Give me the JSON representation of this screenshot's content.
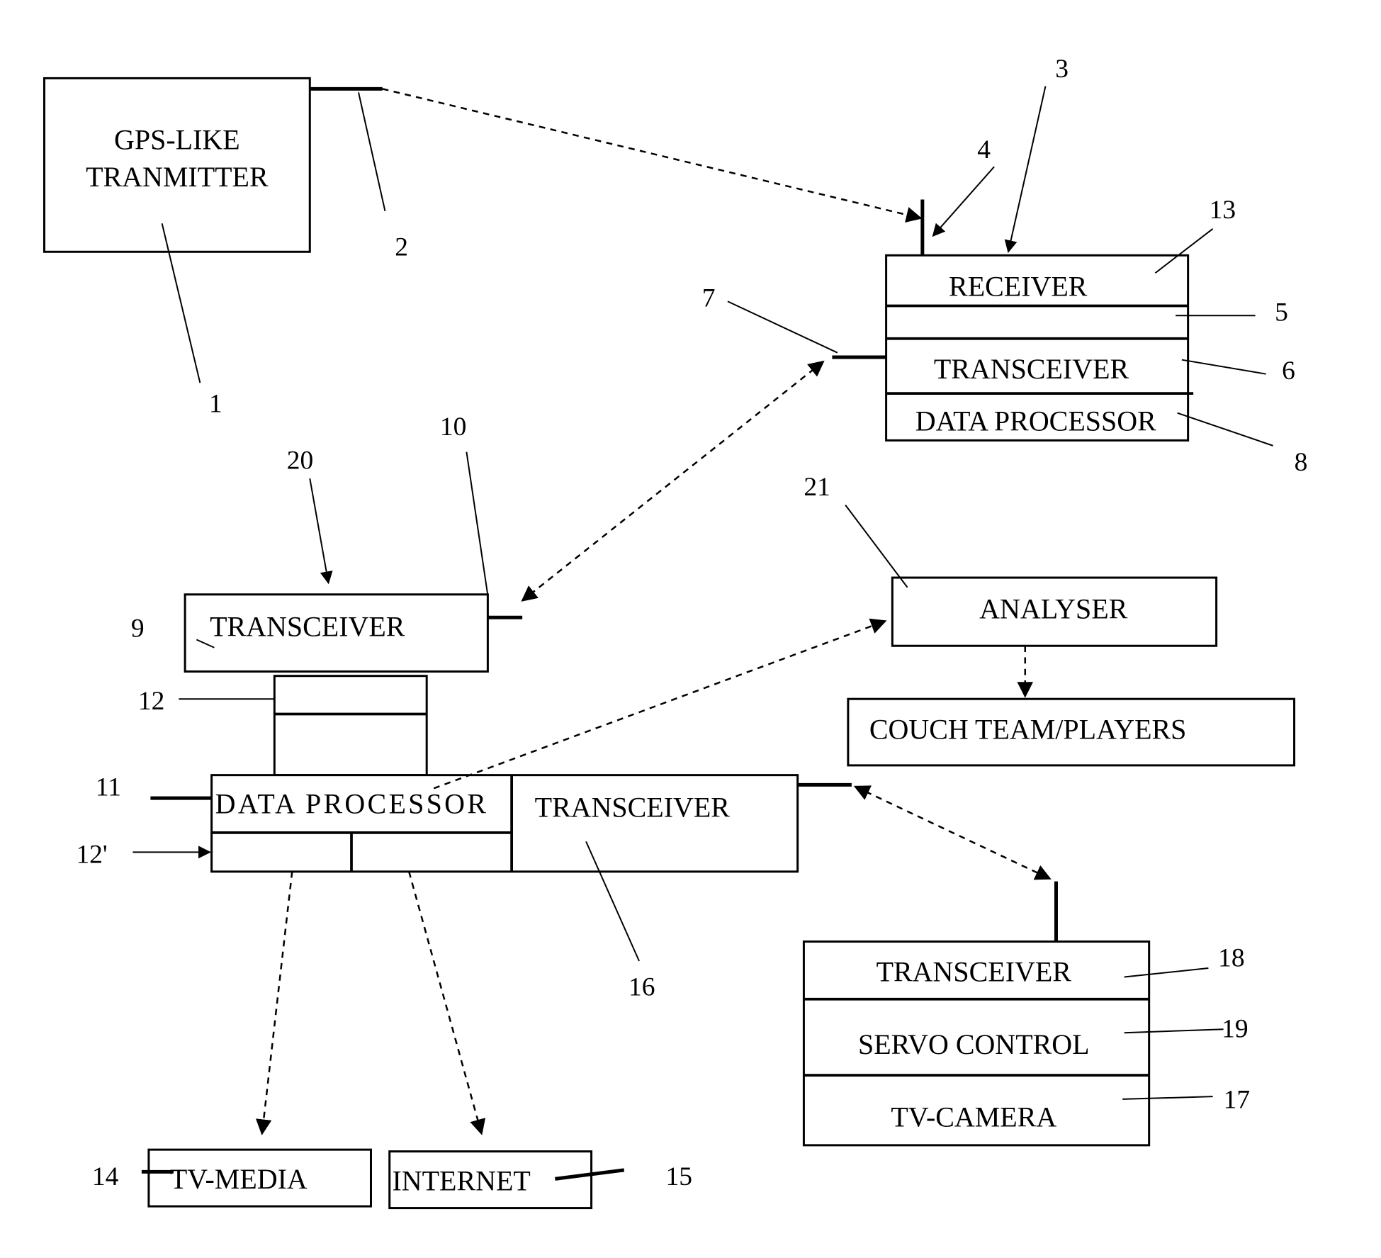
{
  "figure": {
    "blocks": {
      "gps_transmitter": {
        "line1": "GPS-LIKE",
        "line2": "TRANMITTER",
        "ref": "1",
        "antenna_ref": "2"
      },
      "receiver_unit": {
        "receiver": "RECEIVER",
        "transceiver": "TRANSCEIVER",
        "data_processor": "DATA PROCESSOR",
        "refs": {
          "unit": "3",
          "antenna": "4",
          "receiver": "13",
          "middle": "5",
          "transceiver": "6",
          "data_processor": "8",
          "transceiver_antenna": "7"
        }
      },
      "base_transceiver": {
        "label": "TRANSCEIVER",
        "ref": "9",
        "antenna_ref": "10",
        "unit_ref": "20"
      },
      "box_12": {
        "ref": "12"
      },
      "central": {
        "data_processor": "DATA PROCESSOR",
        "transceiver": "TRANSCEIVER",
        "refs": {
          "data_processor": "11",
          "lower": "12'",
          "transceiver": "16"
        }
      },
      "analyser": {
        "label": "ANALYSER",
        "ref": "21"
      },
      "coach": {
        "label": "COUCH TEAM/PLAYERS"
      },
      "camera_unit": {
        "transceiver": "TRANSCEIVER",
        "servo": "SERVO CONTROL",
        "camera": "TV-CAMERA",
        "refs": {
          "transceiver": "18",
          "servo": "19",
          "camera": "17"
        }
      },
      "tv_media": {
        "label": "TV-MEDIA",
        "ref": "14"
      },
      "internet": {
        "label": "INTERNET",
        "ref": "15"
      }
    }
  }
}
